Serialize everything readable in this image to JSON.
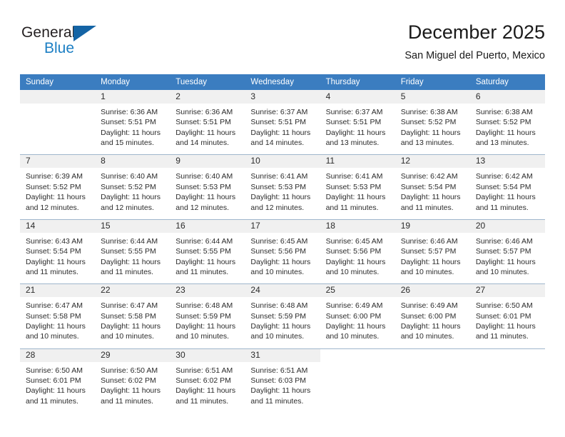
{
  "brand": {
    "name_top": "General",
    "name_bottom": "Blue",
    "flag_color": "#1464a5",
    "blue_text_color": "#1c7fc4"
  },
  "header": {
    "title": "December 2025",
    "subtitle": "San Miguel del Puerto, Mexico"
  },
  "theme": {
    "header_bg": "#3b7dc0",
    "day_band_bg": "#f0f0f0",
    "row_divider": "#9fb6cc",
    "text": "#2b2b2b"
  },
  "weekdays": [
    "Sunday",
    "Monday",
    "Tuesday",
    "Wednesday",
    "Thursday",
    "Friday",
    "Saturday"
  ],
  "weeks": [
    [
      {
        "day": "",
        "lines": []
      },
      {
        "day": "1",
        "lines": [
          "Sunrise: 6:36 AM",
          "Sunset: 5:51 PM",
          "Daylight: 11 hours",
          "and 15 minutes."
        ]
      },
      {
        "day": "2",
        "lines": [
          "Sunrise: 6:36 AM",
          "Sunset: 5:51 PM",
          "Daylight: 11 hours",
          "and 14 minutes."
        ]
      },
      {
        "day": "3",
        "lines": [
          "Sunrise: 6:37 AM",
          "Sunset: 5:51 PM",
          "Daylight: 11 hours",
          "and 14 minutes."
        ]
      },
      {
        "day": "4",
        "lines": [
          "Sunrise: 6:37 AM",
          "Sunset: 5:51 PM",
          "Daylight: 11 hours",
          "and 13 minutes."
        ]
      },
      {
        "day": "5",
        "lines": [
          "Sunrise: 6:38 AM",
          "Sunset: 5:52 PM",
          "Daylight: 11 hours",
          "and 13 minutes."
        ]
      },
      {
        "day": "6",
        "lines": [
          "Sunrise: 6:38 AM",
          "Sunset: 5:52 PM",
          "Daylight: 11 hours",
          "and 13 minutes."
        ]
      }
    ],
    [
      {
        "day": "7",
        "lines": [
          "Sunrise: 6:39 AM",
          "Sunset: 5:52 PM",
          "Daylight: 11 hours",
          "and 12 minutes."
        ]
      },
      {
        "day": "8",
        "lines": [
          "Sunrise: 6:40 AM",
          "Sunset: 5:52 PM",
          "Daylight: 11 hours",
          "and 12 minutes."
        ]
      },
      {
        "day": "9",
        "lines": [
          "Sunrise: 6:40 AM",
          "Sunset: 5:53 PM",
          "Daylight: 11 hours",
          "and 12 minutes."
        ]
      },
      {
        "day": "10",
        "lines": [
          "Sunrise: 6:41 AM",
          "Sunset: 5:53 PM",
          "Daylight: 11 hours",
          "and 12 minutes."
        ]
      },
      {
        "day": "11",
        "lines": [
          "Sunrise: 6:41 AM",
          "Sunset: 5:53 PM",
          "Daylight: 11 hours",
          "and 11 minutes."
        ]
      },
      {
        "day": "12",
        "lines": [
          "Sunrise: 6:42 AM",
          "Sunset: 5:54 PM",
          "Daylight: 11 hours",
          "and 11 minutes."
        ]
      },
      {
        "day": "13",
        "lines": [
          "Sunrise: 6:42 AM",
          "Sunset: 5:54 PM",
          "Daylight: 11 hours",
          "and 11 minutes."
        ]
      }
    ],
    [
      {
        "day": "14",
        "lines": [
          "Sunrise: 6:43 AM",
          "Sunset: 5:54 PM",
          "Daylight: 11 hours",
          "and 11 minutes."
        ]
      },
      {
        "day": "15",
        "lines": [
          "Sunrise: 6:44 AM",
          "Sunset: 5:55 PM",
          "Daylight: 11 hours",
          "and 11 minutes."
        ]
      },
      {
        "day": "16",
        "lines": [
          "Sunrise: 6:44 AM",
          "Sunset: 5:55 PM",
          "Daylight: 11 hours",
          "and 11 minutes."
        ]
      },
      {
        "day": "17",
        "lines": [
          "Sunrise: 6:45 AM",
          "Sunset: 5:56 PM",
          "Daylight: 11 hours",
          "and 10 minutes."
        ]
      },
      {
        "day": "18",
        "lines": [
          "Sunrise: 6:45 AM",
          "Sunset: 5:56 PM",
          "Daylight: 11 hours",
          "and 10 minutes."
        ]
      },
      {
        "day": "19",
        "lines": [
          "Sunrise: 6:46 AM",
          "Sunset: 5:57 PM",
          "Daylight: 11 hours",
          "and 10 minutes."
        ]
      },
      {
        "day": "20",
        "lines": [
          "Sunrise: 6:46 AM",
          "Sunset: 5:57 PM",
          "Daylight: 11 hours",
          "and 10 minutes."
        ]
      }
    ],
    [
      {
        "day": "21",
        "lines": [
          "Sunrise: 6:47 AM",
          "Sunset: 5:58 PM",
          "Daylight: 11 hours",
          "and 10 minutes."
        ]
      },
      {
        "day": "22",
        "lines": [
          "Sunrise: 6:47 AM",
          "Sunset: 5:58 PM",
          "Daylight: 11 hours",
          "and 10 minutes."
        ]
      },
      {
        "day": "23",
        "lines": [
          "Sunrise: 6:48 AM",
          "Sunset: 5:59 PM",
          "Daylight: 11 hours",
          "and 10 minutes."
        ]
      },
      {
        "day": "24",
        "lines": [
          "Sunrise: 6:48 AM",
          "Sunset: 5:59 PM",
          "Daylight: 11 hours",
          "and 10 minutes."
        ]
      },
      {
        "day": "25",
        "lines": [
          "Sunrise: 6:49 AM",
          "Sunset: 6:00 PM",
          "Daylight: 11 hours",
          "and 10 minutes."
        ]
      },
      {
        "day": "26",
        "lines": [
          "Sunrise: 6:49 AM",
          "Sunset: 6:00 PM",
          "Daylight: 11 hours",
          "and 10 minutes."
        ]
      },
      {
        "day": "27",
        "lines": [
          "Sunrise: 6:50 AM",
          "Sunset: 6:01 PM",
          "Daylight: 11 hours",
          "and 11 minutes."
        ]
      }
    ],
    [
      {
        "day": "28",
        "lines": [
          "Sunrise: 6:50 AM",
          "Sunset: 6:01 PM",
          "Daylight: 11 hours",
          "and 11 minutes."
        ]
      },
      {
        "day": "29",
        "lines": [
          "Sunrise: 6:50 AM",
          "Sunset: 6:02 PM",
          "Daylight: 11 hours",
          "and 11 minutes."
        ]
      },
      {
        "day": "30",
        "lines": [
          "Sunrise: 6:51 AM",
          "Sunset: 6:02 PM",
          "Daylight: 11 hours",
          "and 11 minutes."
        ]
      },
      {
        "day": "31",
        "lines": [
          "Sunrise: 6:51 AM",
          "Sunset: 6:03 PM",
          "Daylight: 11 hours",
          "and 11 minutes."
        ]
      },
      {
        "day": "",
        "lines": []
      },
      {
        "day": "",
        "lines": []
      },
      {
        "day": "",
        "lines": []
      }
    ]
  ]
}
